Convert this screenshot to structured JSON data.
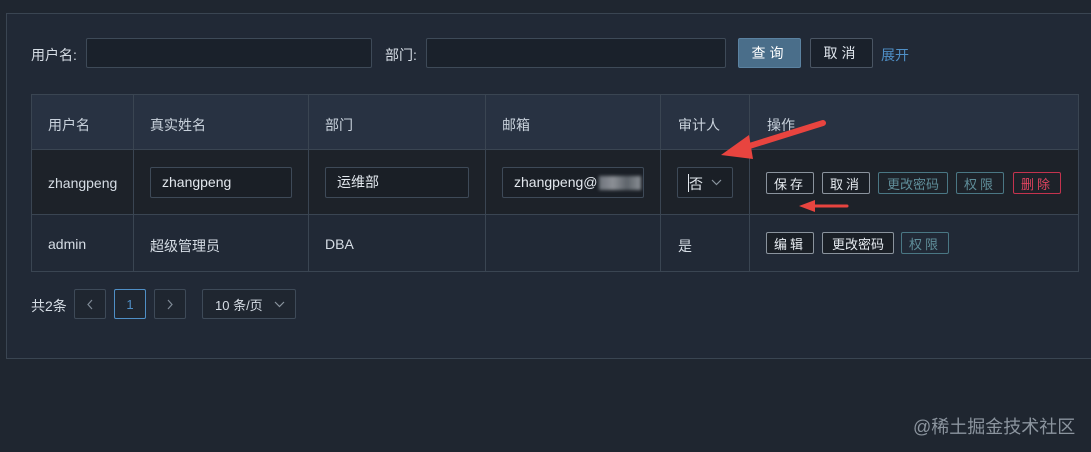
{
  "search": {
    "username_label": "用户名:",
    "department_label": "部门:",
    "username_value": "",
    "department_value": "",
    "query_button": "查询",
    "cancel_button": "取消",
    "expand_link": "展开"
  },
  "table": {
    "headers": [
      "用户名",
      "真实姓名",
      "部门",
      "邮箱",
      "审计人",
      "操作"
    ],
    "rows": [
      {
        "username": "zhangpeng",
        "real_name": "zhangpeng",
        "department": "运维部",
        "email": "zhangpeng@",
        "auditor": "否",
        "actions": [
          "保存",
          "取消",
          "更改密码",
          "权限",
          "删除"
        ]
      },
      {
        "username": "admin",
        "real_name": "超级管理员",
        "department": "DBA",
        "email": "",
        "auditor": "是",
        "actions": [
          "编辑",
          "更改密码",
          "权限"
        ]
      }
    ]
  },
  "pagination": {
    "total": "共2条",
    "prev_icon": "chevron-left-icon",
    "current_page": "1",
    "next_icon": "chevron-right-icon",
    "page_size": "10 条/页"
  },
  "watermark": "@稀土掘金技术社区",
  "colors": {
    "background": "#1f2630",
    "primary_button": "#4a6e8a",
    "link": "#4f8fc6",
    "danger": "#e0445f",
    "annotation_arrow": "#e8443f"
  }
}
